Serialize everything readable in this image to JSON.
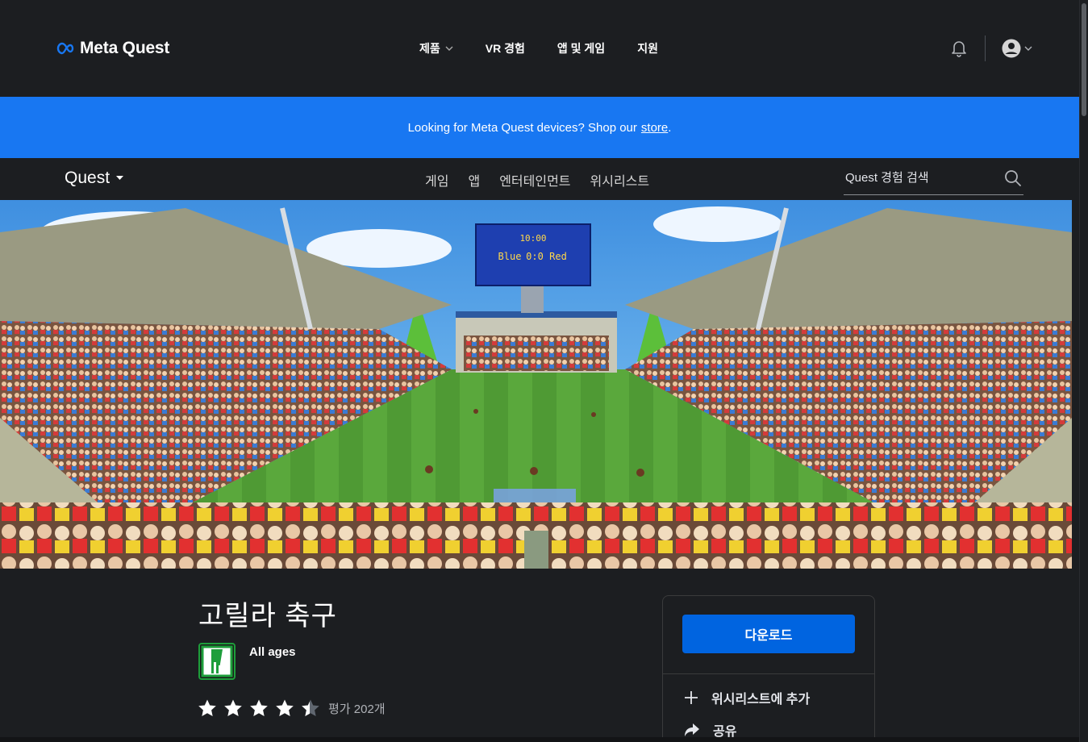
{
  "header": {
    "logo_text": "Meta Quest",
    "nav": [
      {
        "label": "제품",
        "has_dropdown": true
      },
      {
        "label": "VR 경험"
      },
      {
        "label": "앱 및 게임"
      },
      {
        "label": "지원"
      }
    ],
    "icons": {
      "notifications": "bell-icon",
      "account": "account-circle-icon"
    }
  },
  "banner": {
    "text": "Looking for Meta Quest devices? Shop our",
    "link_text": "store",
    "suffix": "."
  },
  "subnav": {
    "brand": "Quest",
    "links": [
      "게임",
      "앱",
      "엔터테인먼트",
      "위시리스트"
    ],
    "search_placeholder": "Quest 경험 검색"
  },
  "hero": {
    "scoreboard_time": "10:00",
    "scoreboard_score_left": "Blue",
    "scoreboard_score": "0:0",
    "scoreboard_score_right": "Red"
  },
  "app": {
    "title": "고릴라 축구",
    "age_rating": "All ages",
    "rating_stars": 4.4,
    "rating_count_text": "평가 202개"
  },
  "sidebar": {
    "download_label": "다운로드",
    "wishlist_label": "위시리스트에 추가",
    "share_label": "공유"
  },
  "colors": {
    "background": "#1c1e21",
    "banner": "#1877f2",
    "primary_button": "#0064e0",
    "rating_border": "#1e9e3b"
  }
}
